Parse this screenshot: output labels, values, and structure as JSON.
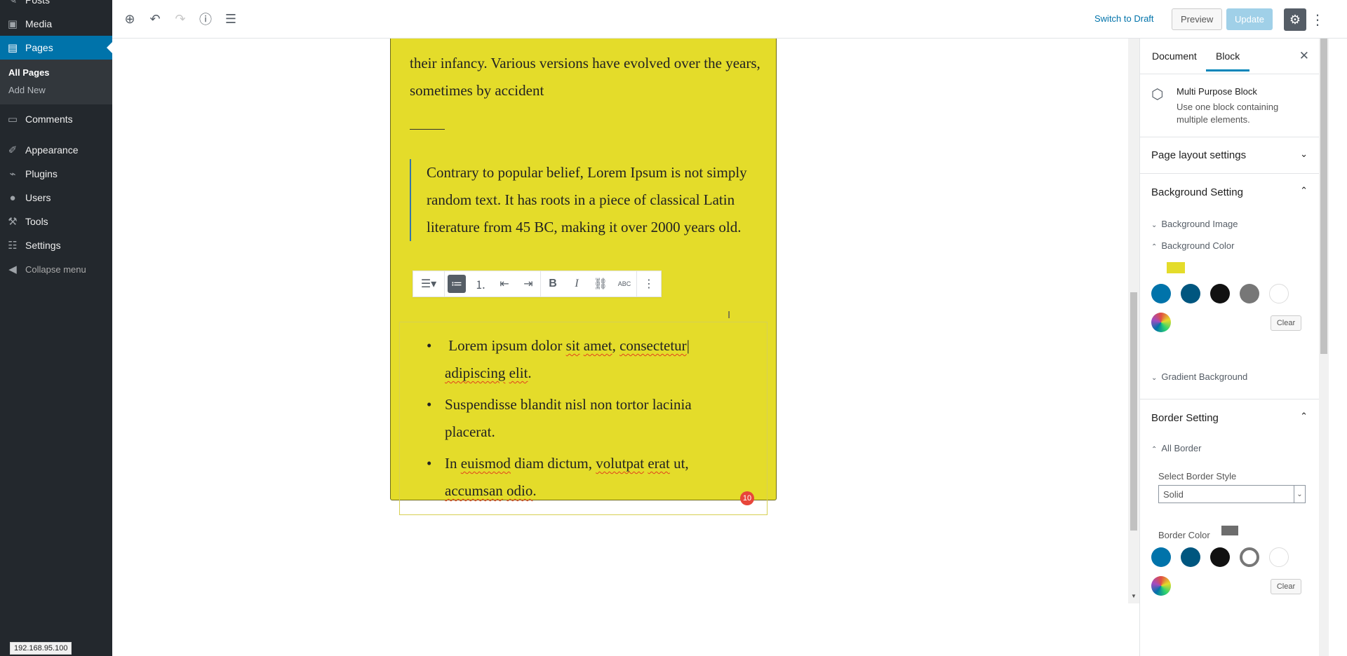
{
  "admin_menu": {
    "items": [
      {
        "label": "Posts",
        "icon": "pushpin-icon"
      },
      {
        "label": "Media",
        "icon": "media-icon"
      },
      {
        "label": "Pages",
        "icon": "pages-icon"
      },
      {
        "label": "Comments",
        "icon": "comments-icon"
      },
      {
        "label": "Appearance",
        "icon": "brush-icon"
      },
      {
        "label": "Plugins",
        "icon": "plugin-icon"
      },
      {
        "label": "Users",
        "icon": "users-icon"
      },
      {
        "label": "Tools",
        "icon": "wrench-icon"
      },
      {
        "label": "Settings",
        "icon": "settings-icon"
      },
      {
        "label": "Collapse menu",
        "icon": "collapse-icon"
      }
    ],
    "pages_submenu": [
      "All Pages",
      "Add New"
    ],
    "status_url": "192.168.95.100"
  },
  "header": {
    "switch_to_draft": "Switch to Draft",
    "preview": "Preview",
    "update": "Update"
  },
  "content": {
    "paragraph": "their infancy. Various versions have evolved over the years, sometimes by accident",
    "quote": "Contrary to popular belief, Lorem Ipsum is not simply random text. It has roots in a piece of classical Latin literature from 45 BC, making it over 2000 years old.",
    "list_items": [
      "Lorem ipsum dolor sit amet, consectetur adipiscing elit.",
      "Suspendisse blandit nisl non tortor lacinia placerat.",
      "In euismod diam dictum, volutpat erat ut, accumsan odio."
    ],
    "grammar_count": "10",
    "block_color": "#e4dc2a"
  },
  "settings": {
    "tabs": [
      "Document",
      "Block"
    ],
    "active_tab": "Block",
    "block_title": "Multi Purpose Block",
    "block_description": "Use one block containing multiple elements.",
    "page_layout": "Page layout settings",
    "background_setting": "Background Setting",
    "background_image": "Background Image",
    "background_color": "Background Color",
    "gradient_background": "Gradient Background",
    "border_setting": "Border Setting",
    "all_border": "All Border",
    "select_border_style": "Select Border Style",
    "border_style_value": "Solid",
    "border_color": "Border Color",
    "clear": "Clear",
    "selected_bg_color": "#e4dc2a",
    "selected_border_color": "#6d6d6d",
    "palette": [
      "#0073aa",
      "#00567f",
      "#111111",
      "#777777",
      "#ffffff"
    ]
  }
}
